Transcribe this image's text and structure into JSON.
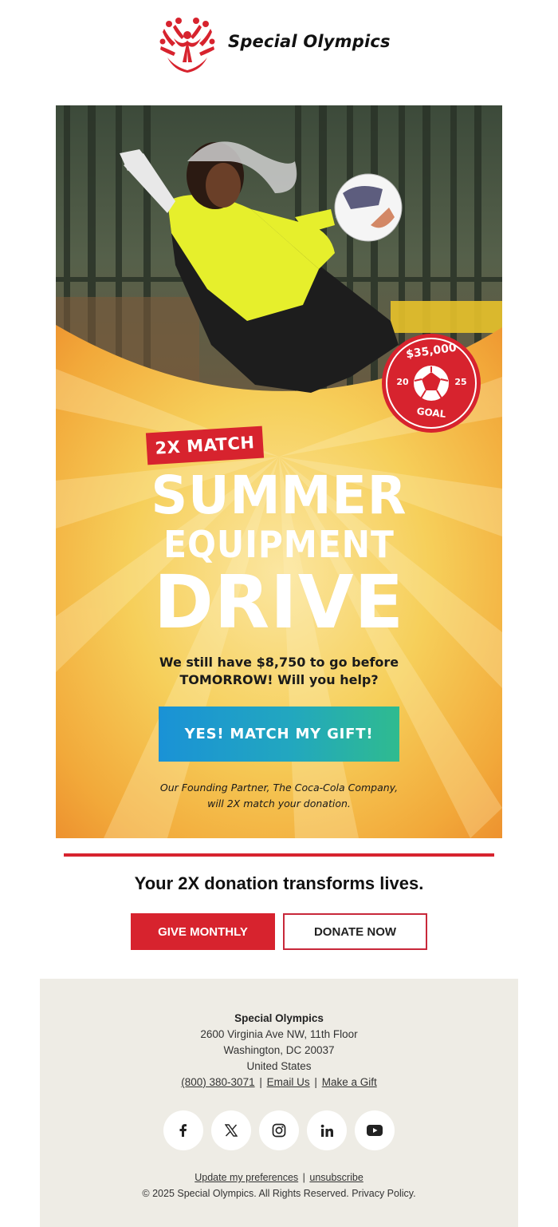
{
  "header": {
    "logo_text": "Special Olympics"
  },
  "hero": {
    "badge_goal_amount": "$35,000",
    "badge_year_left": "20",
    "badge_year_right": "25",
    "badge_goal_label": "GOAL",
    "match_badge": "2X MATCH",
    "headline_line1": "SUMMER",
    "headline_line2": "EQUIPMENT",
    "headline_line3": "DRIVE",
    "body_line1": "We still have $8,750 to go before",
    "body_line2": "TOMORROW! Will you help?",
    "cta_label": "YES! MATCH MY GIFT!",
    "partner_line1": "Our Founding Partner, The Coca-Cola Company,",
    "partner_line2": "will 2X match your donation."
  },
  "main": {
    "tagline": "Your 2X donation transforms lives.",
    "give_monthly_label": "GIVE MONTHLY",
    "donate_now_label": "DONATE NOW"
  },
  "footer": {
    "org_name": "Special Olympics",
    "address_line1": "2600 Virginia Ave NW, 11th Floor",
    "address_line2": "Washington, DC 20037",
    "address_line3": "United States",
    "phone": "(800) 380-3071",
    "separator": "|",
    "email_link": "Email Us",
    "gift_link": "Make a Gift",
    "prefs_link": "Update my preferences",
    "unsubscribe_link": "unsubscribe",
    "copyright": "© 2025 Special Olympics. All Rights Reserved. Privacy Policy.",
    "social_icons": [
      "facebook-icon",
      "x-icon",
      "instagram-icon",
      "linkedin-icon",
      "youtube-icon"
    ]
  },
  "colors": {
    "brand_red": "#d7232e",
    "hero_yellow": "#f5c23b",
    "cta_blue": "#1a92d6",
    "cta_green": "#2fbb8f",
    "footer_bg": "#eeece5"
  }
}
